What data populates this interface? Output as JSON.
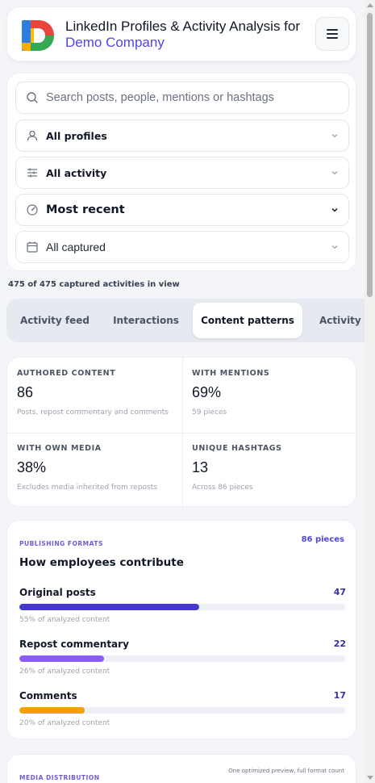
{
  "header": {
    "title_line1": "LinkedIn Profiles & Activity Analysis for",
    "title_line2": "Demo Company",
    "logo_icon": "d-logo-icon",
    "menu_icon": "hamburger-menu-icon"
  },
  "filters": {
    "search_placeholder": "Search posts, people, mentions or hashtags",
    "profiles": "All profiles",
    "activity": "All activity",
    "sort": "Most recent",
    "captured": "All captured"
  },
  "count_text": "475 of 475 captured activities in view",
  "tabs": [
    {
      "label": "Activity feed",
      "active": false
    },
    {
      "label": "Interactions",
      "active": false
    },
    {
      "label": "Content patterns",
      "active": true
    },
    {
      "label": "Activity",
      "active": false
    }
  ],
  "stats": [
    {
      "label": "AUTHORED CONTENT",
      "value": "86",
      "sub": "Posts, repost commentary and comments"
    },
    {
      "label": "WITH MENTIONS",
      "value": "69%",
      "sub": "59 pieces"
    },
    {
      "label": "WITH OWN MEDIA",
      "value": "38%",
      "sub": "Excludes media inherited from reposts"
    },
    {
      "label": "UNIQUE HASHTAGS",
      "value": "13",
      "sub": "Across 86 pieces"
    }
  ],
  "formats": {
    "eyebrow": "PUBLISHING FORMATS",
    "pieces": "86 pieces",
    "title": "How employees contribute",
    "rows": [
      {
        "name": "Original posts",
        "count": "47",
        "pct_text": "55% of analyzed content",
        "fraction": 0.55,
        "color": "#4338ca"
      },
      {
        "name": "Repost commentary",
        "count": "22",
        "pct_text": "26% of analyzed content",
        "fraction": 0.26,
        "color": "#8b5cf6"
      },
      {
        "name": "Comments",
        "count": "17",
        "pct_text": "20% of analyzed content",
        "fraction": 0.2,
        "color": "#f59e0b"
      }
    ]
  },
  "media": {
    "eyebrow": "MEDIA DISTRIBUTION",
    "note": "One optimized preview, full format count"
  },
  "colors": {
    "accent": "#4f46e5",
    "eyebrow": "#6d5dd3",
    "page_bg": "#f4f5f8"
  }
}
